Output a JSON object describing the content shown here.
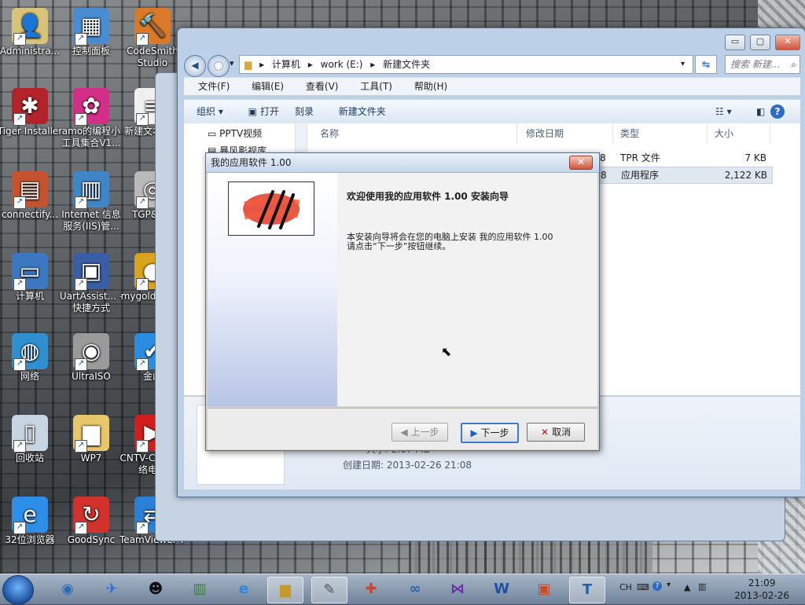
{
  "desktop": {
    "icons": [
      {
        "label": "Administra...",
        "glyph": "👤",
        "color": "#d8c37b"
      },
      {
        "label": "控制面板",
        "glyph": "▦",
        "color": "#4a8cd1"
      },
      {
        "label": "CodeSmith Studio",
        "glyph": "🔨",
        "color": "#d87a29"
      },
      {
        "label": "Tiger Installer",
        "glyph": "✱",
        "color": "#b2242a"
      },
      {
        "label": "amo的编程小工具集合V1...",
        "glyph": "✿",
        "color": "#d42f88"
      },
      {
        "label": "新建文本文档",
        "glyph": "≡",
        "color": "#f0f0f0"
      },
      {
        "label": "connectify...",
        "glyph": "▤",
        "color": "#c6532f"
      },
      {
        "label": "Internet 信息服务(IIS)管...",
        "glyph": "▥",
        "color": "#3f86c8"
      },
      {
        "label": "TGP&QQ",
        "glyph": "◎",
        "color": "#b9b9b9"
      },
      {
        "label": "计算机",
        "glyph": "▭",
        "color": "#3c78c2"
      },
      {
        "label": "UartAssist... - 快捷方式",
        "glyph": "▣",
        "color": "#3a5ea6"
      },
      {
        "label": "mygold - 快捷",
        "glyph": "●",
        "color": "#d9a21f"
      },
      {
        "label": "网络",
        "glyph": "◍",
        "color": "#2f8fd0"
      },
      {
        "label": "UltraISO",
        "glyph": "◉",
        "color": "#9a9a9a"
      },
      {
        "label": "金山",
        "glyph": "✔",
        "color": "#2a8de0"
      },
      {
        "label": "回收站",
        "glyph": "▯",
        "color": "#c7d5e3"
      },
      {
        "label": "WP7",
        "glyph": "▆",
        "color": "#e8c66b"
      },
      {
        "label": "CNTV-CBox 网络电视",
        "glyph": "▶",
        "color": "#d01e1e"
      },
      {
        "label": "32位浏览器",
        "glyph": "e",
        "color": "#2d8ee8"
      },
      {
        "label": "GoodSync",
        "glyph": "↻",
        "color": "#d2322b"
      },
      {
        "label": "TeamViewer 7",
        "glyph": "⇄",
        "color": "#2a7fd6"
      }
    ]
  },
  "explorer": {
    "window_controls": {
      "minimize": "▭",
      "maximize": "▢",
      "close": "✕"
    },
    "nav": {
      "back": "◀",
      "forward": "◯",
      "dropdown": "▾"
    },
    "breadcrumb": [
      "计算机",
      "work (E:)",
      "新建文件夹"
    ],
    "refresh_icon": "↹",
    "search_placeholder": "搜索 新建...",
    "menu": [
      "文件(F)",
      "编辑(E)",
      "查看(V)",
      "工具(T)",
      "帮助(H)"
    ],
    "toolbar": [
      "组织 ▾",
      "打开",
      "刻录",
      "新建文件夹"
    ],
    "nav_pane": [
      "PPTV视频",
      "暴风影视库"
    ],
    "columns": [
      "名称",
      "修改日期",
      "类型",
      "大小"
    ],
    "files": [
      {
        "date": "8",
        "type": "TPR 文件",
        "size": "7 KB"
      },
      {
        "date": "8",
        "type": "应用程序",
        "size": "2,122 KB"
      }
    ],
    "details": {
      "size_line": "大小: 2.07 MB",
      "created_line": "创建日期: 2013-02-26 21:08"
    }
  },
  "dialog": {
    "title": "我的应用软件 1.00",
    "close": "✕",
    "heading": "欢迎使用我的应用软件 1.00 安装向导",
    "body_line1": "本安装向导将会在您的电脑上安装 我的应用软件 1.00",
    "body_line2": "请点击“下一步”按钮继续。",
    "buttons": {
      "back": "上一步",
      "next": "下一步",
      "cancel": "取消"
    }
  },
  "taskbar": {
    "tray_lang": "CH",
    "time": "21:09",
    "date": "2013-02-26"
  }
}
